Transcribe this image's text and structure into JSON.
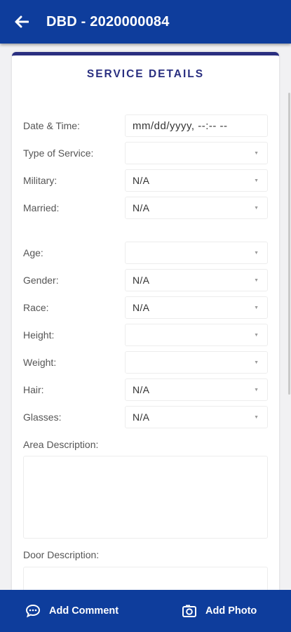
{
  "header": {
    "title": "DBD - 2020000084"
  },
  "section": {
    "title": "SERVICE DETAILS"
  },
  "fields": [
    {
      "label": "Date & Time:",
      "value": "mm/dd/yyyy, --:-- --"
    },
    {
      "label": "Type of Service:",
      "value": ""
    },
    {
      "label": "Military:",
      "value": "N/A"
    },
    {
      "label": "Married:",
      "value": "N/A"
    },
    {
      "label": "Age:",
      "value": ""
    },
    {
      "label": "Gender:",
      "value": "N/A"
    },
    {
      "label": "Race:",
      "value": "N/A"
    },
    {
      "label": "Height:",
      "value": ""
    },
    {
      "label": "Weight:",
      "value": ""
    },
    {
      "label": "Hair:",
      "value": "N/A"
    },
    {
      "label": "Glasses:",
      "value": "N/A"
    }
  ],
  "area_description": {
    "label": "Area Description:",
    "value": ""
  },
  "door_description": {
    "label": "Door Description:",
    "value": ""
  },
  "footer": {
    "add_comment": "Add Comment",
    "add_photo": "Add Photo"
  },
  "colors": {
    "primary": "#0e3d9c",
    "accent": "#2a2f80",
    "background": "#f1f1f3"
  }
}
